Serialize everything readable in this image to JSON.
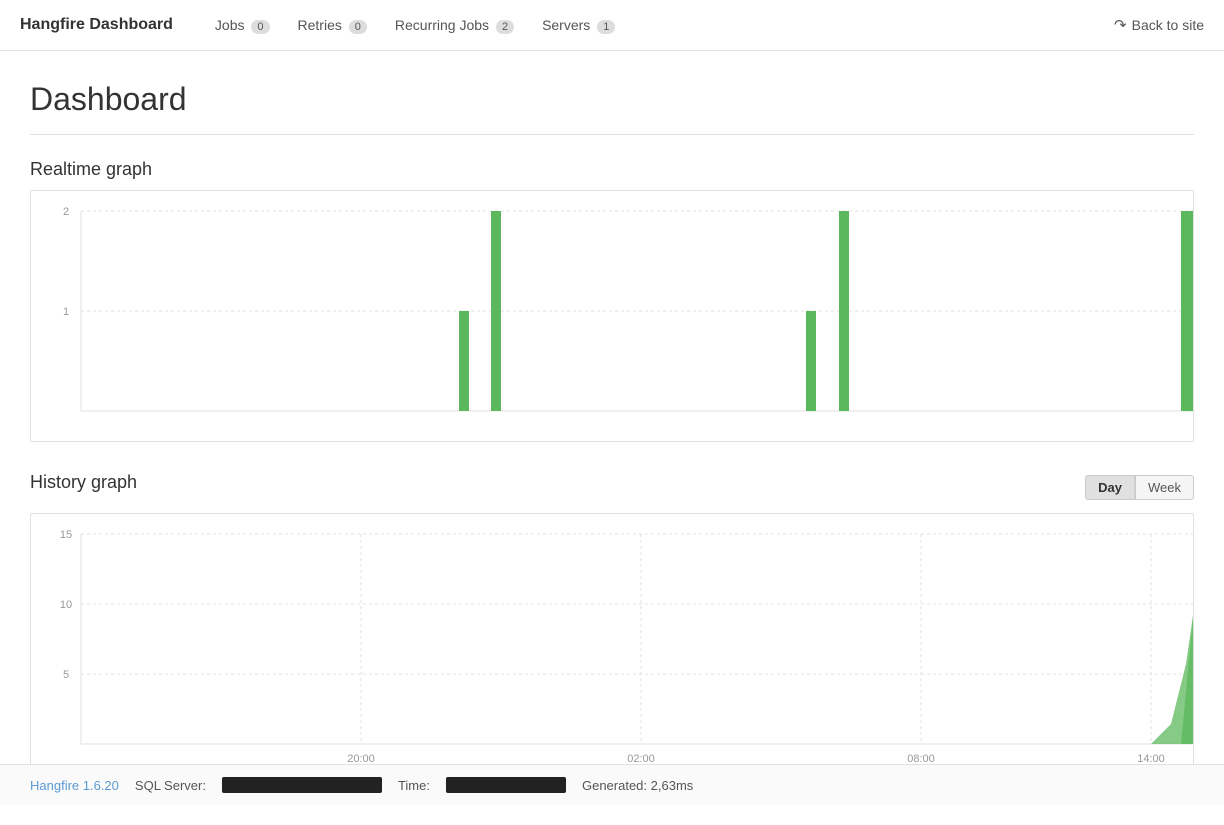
{
  "navbar": {
    "brand": "Hangfire Dashboard",
    "nav_items": [
      {
        "label": "Jobs",
        "badge": "0",
        "key": "jobs"
      },
      {
        "label": "Retries",
        "badge": "0",
        "key": "retries"
      },
      {
        "label": "Recurring Jobs",
        "badge": "2",
        "key": "recurring"
      },
      {
        "label": "Servers",
        "badge": "1",
        "key": "servers"
      }
    ],
    "back_label": "Back to site"
  },
  "page": {
    "title": "Dashboard"
  },
  "realtime_graph": {
    "title": "Realtime graph",
    "y_labels": [
      "2",
      "1"
    ],
    "bars": [
      {
        "x_pct": 35,
        "height_pct": 50,
        "color": "#5cb85c"
      },
      {
        "x_pct": 38,
        "height_pct": 100,
        "color": "#5cb85c"
      },
      {
        "x_pct": 64,
        "height_pct": 50,
        "color": "#5cb85c"
      },
      {
        "x_pct": 67,
        "height_pct": 100,
        "color": "#5cb85c"
      },
      {
        "x_pct": 97,
        "height_pct": 100,
        "color": "#5cb85c"
      }
    ]
  },
  "history_graph": {
    "title": "History graph",
    "day_label": "Day",
    "week_label": "Week",
    "y_labels": [
      "15",
      "10",
      "5"
    ],
    "x_labels": [
      "20:00",
      "02:00",
      "08:00",
      "14:00"
    ],
    "active_btn": "Day"
  },
  "footer": {
    "version_label": "Hangfire 1.6.20",
    "sql_server_label": "SQL Server:",
    "time_label": "Time:",
    "generated_label": "Generated: 2,63ms"
  }
}
